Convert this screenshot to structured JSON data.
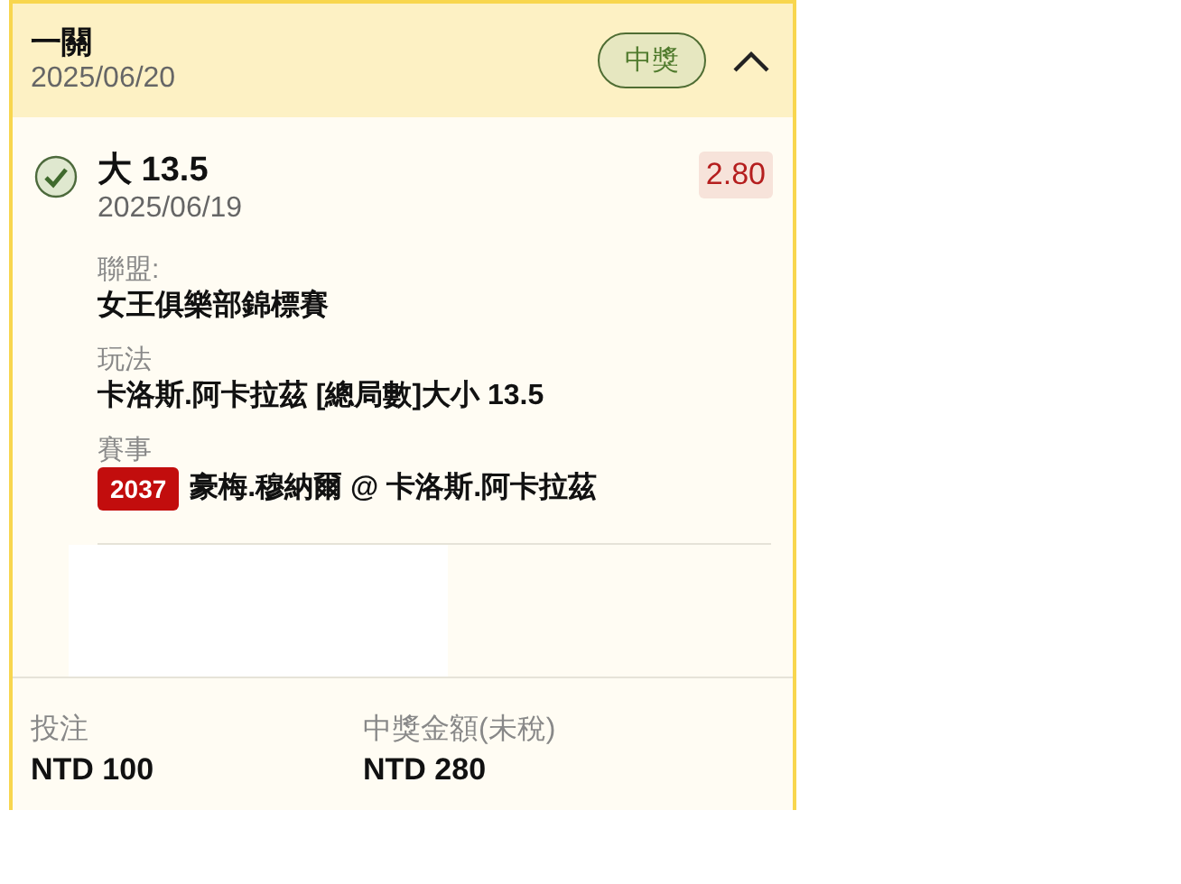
{
  "header": {
    "title": "一關",
    "date": "2025/06/20",
    "status": "中獎",
    "expanded": true
  },
  "selection": {
    "won": true,
    "pick": "大 13.5",
    "date": "2025/06/19",
    "odds": "2.80",
    "details": [
      {
        "label": "聯盟:",
        "value": "女王俱樂部錦標賽"
      },
      {
        "label": "玩法",
        "value": "卡洛斯.阿卡拉茲 [總局數]大小 13.5"
      },
      {
        "label": "賽事",
        "badge": "2037",
        "value": "豪梅.穆納爾 @ 卡洛斯.阿卡拉茲"
      }
    ]
  },
  "footer": [
    {
      "label": "投注",
      "value": "NTD 100"
    },
    {
      "label": "中獎金額(未稅)",
      "value": "NTD 280"
    }
  ]
}
